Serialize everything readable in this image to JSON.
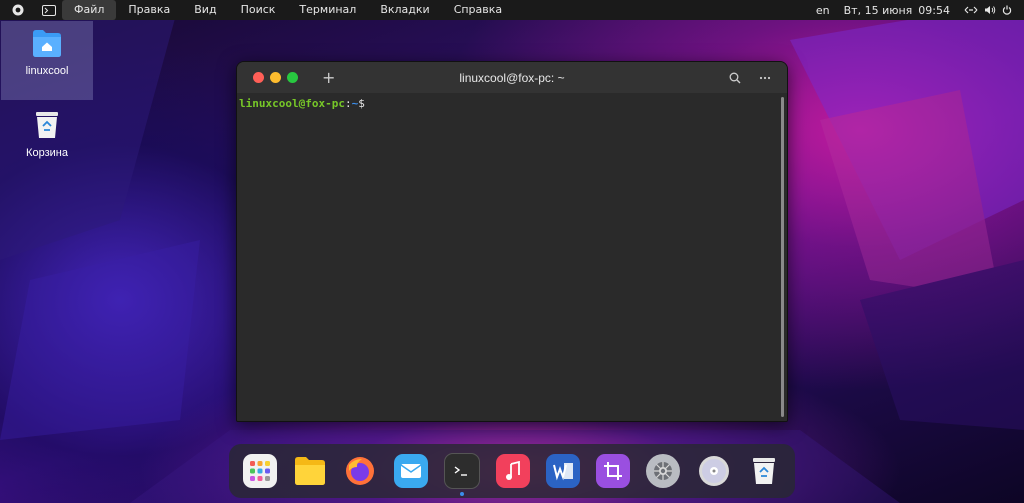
{
  "topbar": {
    "menu": [
      "Файл",
      "Правка",
      "Вид",
      "Поиск",
      "Терминал",
      "Вкладки",
      "Справка"
    ],
    "active_menu_index": 0,
    "keyboard_layout": "en",
    "date": "Вт, 15 июня",
    "time": "09:54"
  },
  "desktop": {
    "icons": [
      {
        "label": "linuxcool",
        "icon": "home-folder-icon",
        "selected": true
      },
      {
        "label": "Корзина",
        "icon": "trash-icon",
        "selected": false
      }
    ]
  },
  "terminal": {
    "title": "linuxcool@fox-pc: ~",
    "prompt_user": "linuxcool@fox-pc",
    "prompt_sep": ":",
    "prompt_path": "~",
    "prompt_symbol": "$"
  },
  "dock": {
    "items": [
      "app-grid-icon",
      "files-icon",
      "firefox-icon",
      "mail-icon",
      "terminal-icon",
      "music-icon",
      "word-icon",
      "screenshot-crop-icon",
      "settings-icon",
      "disc-icon",
      "trash-icon"
    ],
    "running": "terminal-icon"
  },
  "colors": {
    "close": "#ff5f57",
    "minimize": "#febc2e",
    "maximize": "#28c840",
    "prompt_user": "#77c728",
    "prompt_path": "#3b8eea"
  }
}
